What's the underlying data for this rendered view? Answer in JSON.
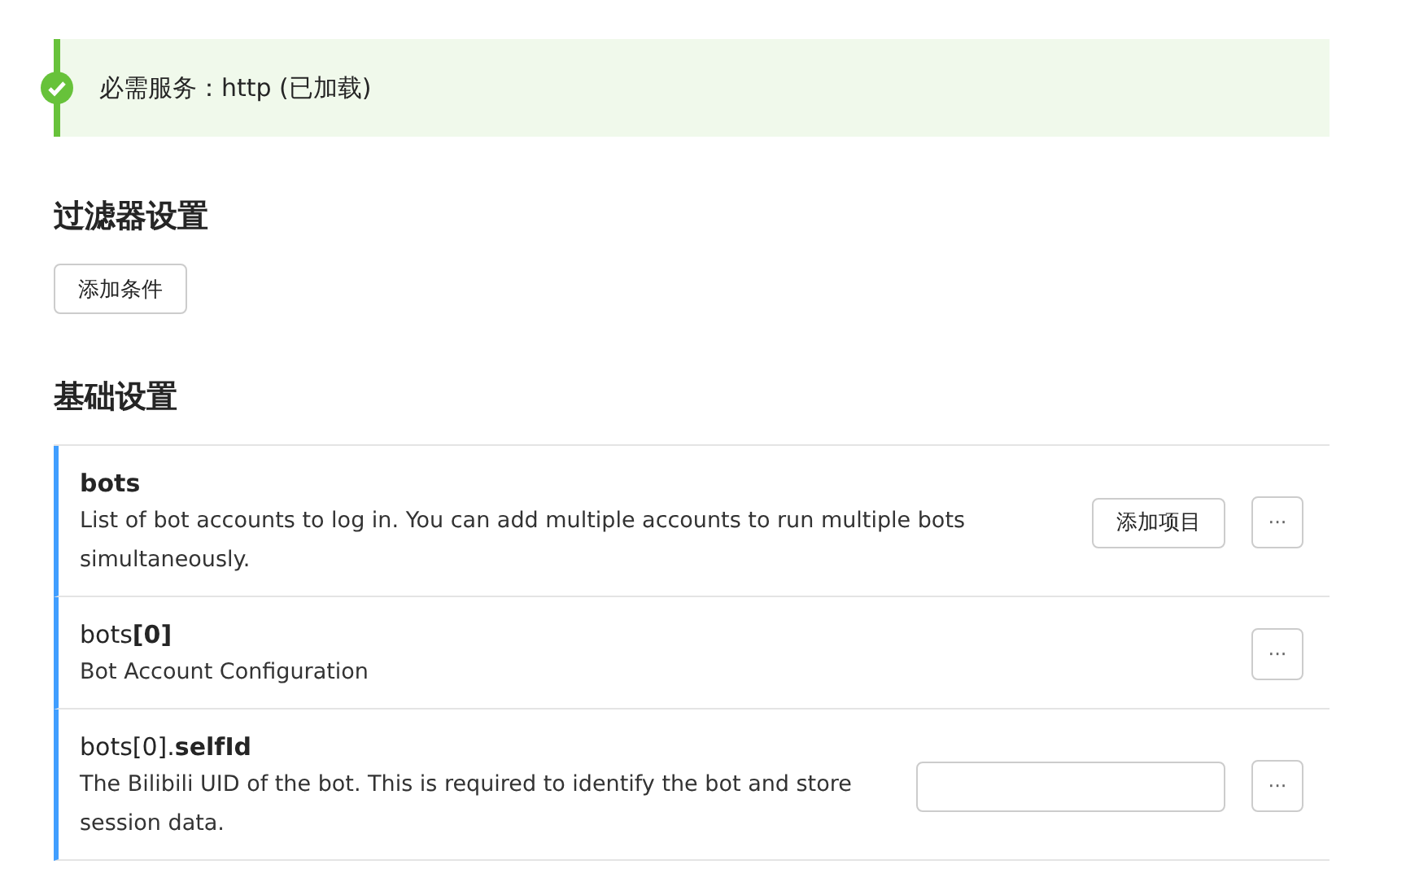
{
  "banner": {
    "text": "必需服务：http (已加载)",
    "ok": true
  },
  "filter_section": {
    "title": "过滤器设置",
    "button": "添加条件"
  },
  "basic_section": {
    "title": "基础设置",
    "rows": [
      {
        "kind": "list",
        "title": "bots",
        "description": "List of bot accounts to log in. You can add multiple accounts to run multiple bots simultaneously.",
        "button": "添加项目",
        "menu": "···"
      },
      {
        "kind": "object",
        "title": "bots**[0]**",
        "description": "Bot Account Configuration",
        "menu": "···"
      },
      {
        "kind": "input",
        "title": "bots[0].**selfId**",
        "description": "The Bilibili UID of the bot. This is required to identify the bot and store session data.",
        "menu": "···"
      }
    ]
  }
}
